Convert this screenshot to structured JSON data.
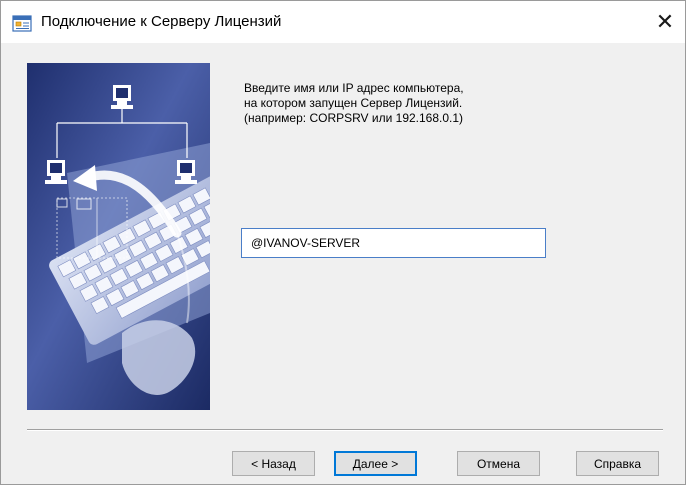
{
  "window": {
    "title": "Подключение к Серверу Лицензий",
    "close_glyph": "✕"
  },
  "instructions": {
    "line1": "Введите имя или IP адрес компьютера,",
    "line2": "на котором запущен Сервер Лицензий.",
    "line3": "(например: CORPSRV или 192.168.0.1)"
  },
  "server_field": {
    "value": "@IVANOV-SERVER"
  },
  "buttons": {
    "back": "< Назад",
    "next": "Далее >",
    "cancel": "Отмена",
    "help": "Справка"
  },
  "colors": {
    "accent": "#0078d7",
    "input_border": "#4a7ec8",
    "image_dark": "#1f2f6e",
    "image_light": "#c9d3ea"
  }
}
